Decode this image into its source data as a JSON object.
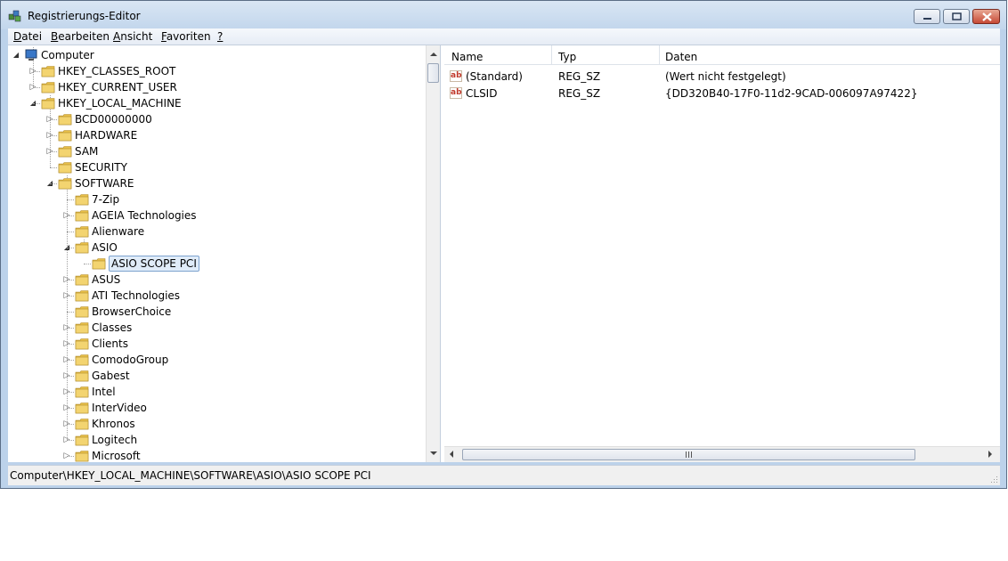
{
  "window": {
    "title": "Registrierungs-Editor"
  },
  "menu": [
    {
      "acc": "D",
      "rest": "atei"
    },
    {
      "acc": "B",
      "rest": "earbeiten"
    },
    {
      "acc": "A",
      "rest": "nsicht"
    },
    {
      "acc": "F",
      "rest": "avoriten"
    },
    {
      "acc": "?",
      "rest": ""
    }
  ],
  "tree": {
    "root": "Computer",
    "nodes": [
      "HKEY_CLASSES_ROOT",
      "HKEY_CURRENT_USER",
      "HKEY_LOCAL_MACHINE",
      "BCD00000000",
      "HARDWARE",
      "SAM",
      "SECURITY",
      "SOFTWARE",
      "7-Zip",
      "AGEIA Technologies",
      "Alienware",
      "ASIO",
      "ASIO SCOPE PCI",
      "ASUS",
      "ATI Technologies",
      "BrowserChoice",
      "Classes",
      "Clients",
      "ComodoGroup",
      "Gabest",
      "Intel",
      "InterVideo",
      "Khronos",
      "Logitech",
      "Microsoft"
    ],
    "selected": "ASIO SCOPE PCI"
  },
  "values": {
    "headers": {
      "name": "Name",
      "type": "Typ",
      "data": "Daten"
    },
    "rows": [
      {
        "name": "(Standard)",
        "type": "REG_SZ",
        "data": "(Wert nicht festgelegt)",
        "icon": "string-value-icon"
      },
      {
        "name": "CLSID",
        "type": "REG_SZ",
        "data": "{DD320B40-17F0-11d2-9CAD-006097A97422}",
        "icon": "string-value-icon"
      }
    ]
  },
  "status": {
    "path": "Computer\\HKEY_LOCAL_MACHINE\\SOFTWARE\\ASIO\\ASIO SCOPE PCI"
  },
  "colors": {
    "selection": "#e0ecf9",
    "folder": "#e8c04a",
    "title_bar": "#c2d6ec"
  }
}
